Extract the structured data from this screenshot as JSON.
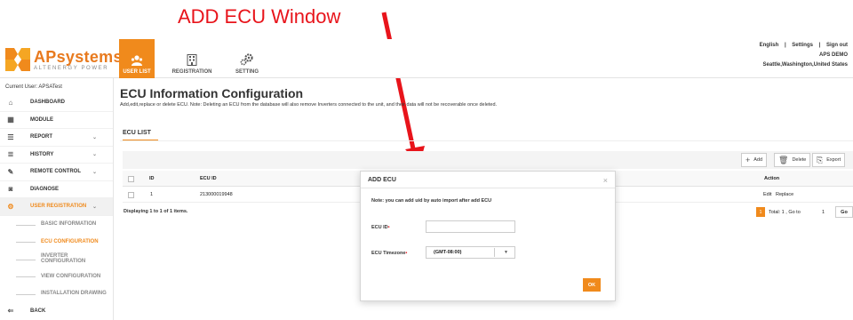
{
  "annotation": {
    "title": "ADD ECU Window",
    "color": "#e8141b"
  },
  "brand": {
    "name": "APsystems",
    "tagline": "ALTENERGY POWER",
    "accent": "#f08a1c"
  },
  "topnav": [
    {
      "label": "USER LIST",
      "icon": "users-icon",
      "active": true
    },
    {
      "label": "REGISTRATION",
      "icon": "building-icon",
      "active": false
    },
    {
      "label": "SETTING",
      "icon": "gears-icon",
      "active": false
    }
  ],
  "topright": {
    "language": "English",
    "separator": "|",
    "settings": "Settings",
    "signout": "Sign out",
    "account": "APS DEMO",
    "location": "Seattle,Washington,United States"
  },
  "sidebar": {
    "current_user": "Current User: APSATest",
    "items": [
      {
        "label": "DASHBOARD",
        "icon": "home-icon"
      },
      {
        "label": "MODULE",
        "icon": "grid-icon"
      },
      {
        "label": "REPORT",
        "icon": "list-icon",
        "chevron": "⌄"
      },
      {
        "label": "HISTORY",
        "icon": "database-icon",
        "chevron": "⌄"
      },
      {
        "label": "REMOTE CONTROL",
        "icon": "wrench-icon",
        "chevron": "⌄"
      },
      {
        "label": "DIAGNOSE",
        "icon": "camera-icon"
      },
      {
        "label": "USER REGISTRATION",
        "icon": "gears-icon",
        "chevron": "⌄"
      }
    ],
    "subitems": [
      "BASIC INFORMATION",
      "ECU CONFIGURATION",
      "INVERTER CONFIGURATION",
      "VIEW CONFIGURATION",
      "INSTALLATION DRAWING"
    ],
    "back": "BACK"
  },
  "main": {
    "title": "ECU Information Configuration",
    "description": "Add,edit,replace or delete ECU. Note: Deleting an ECU from the database will also remove Inverters connected to the unit, and their data will not be recoverable once deleted.",
    "section": "ECU LIST",
    "toolbar": {
      "add": "Add",
      "delete": "Delete",
      "export": "Export"
    },
    "columns": {
      "id": "ID",
      "ecu_id": "ECU ID",
      "action": "Action"
    },
    "rows": [
      {
        "id": "1",
        "ecu_id": "213000019948",
        "edit": "Edit",
        "replace": "Replace"
      }
    ],
    "pager": {
      "display": "Displaying 1 to 1 of 1 items.",
      "page": "1",
      "total": "Total: 1 , Go to",
      "goto_value": "1",
      "go": "Go"
    }
  },
  "modal": {
    "title": "ADD ECU",
    "close": "×",
    "note": "Note: you can add uid by auto import after add ECU",
    "ecu_id_label": "ECU ID",
    "ecu_id_value": "",
    "timezone_label": "ECU Timezone",
    "timezone_value": "(GMT-08:00)",
    "required_mark": "•",
    "ok": "OK"
  }
}
